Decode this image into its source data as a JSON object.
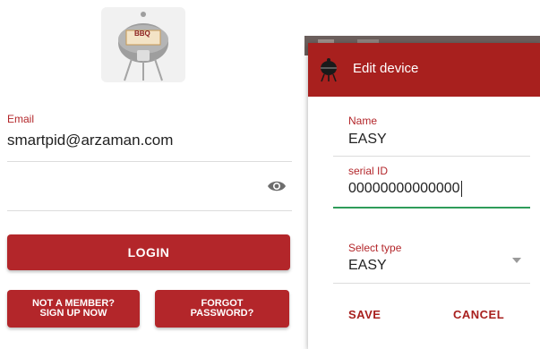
{
  "login": {
    "logo_text": "BBQ",
    "email_label": "Email",
    "email_value": "smartpid@arzaman.com",
    "password_value": "",
    "login_label": "LOGIN",
    "signup_line1": "NOT A MEMBER?",
    "signup_line2": "SIGN UP NOW",
    "forgot_line1": "FORGOT",
    "forgot_line2": "PASSWORD?"
  },
  "dialog": {
    "title": "Edit device",
    "name_label": "Name",
    "name_value": "EASY",
    "serial_label": "serial ID",
    "serial_value": "00000000000000",
    "type_label": "Select type",
    "type_value": "EASY",
    "save_label": "SAVE",
    "cancel_label": "CANCEL"
  },
  "colors": {
    "brand_red": "#b3262a",
    "header_red": "#a8201e",
    "focus_green": "#2e9c5a"
  }
}
